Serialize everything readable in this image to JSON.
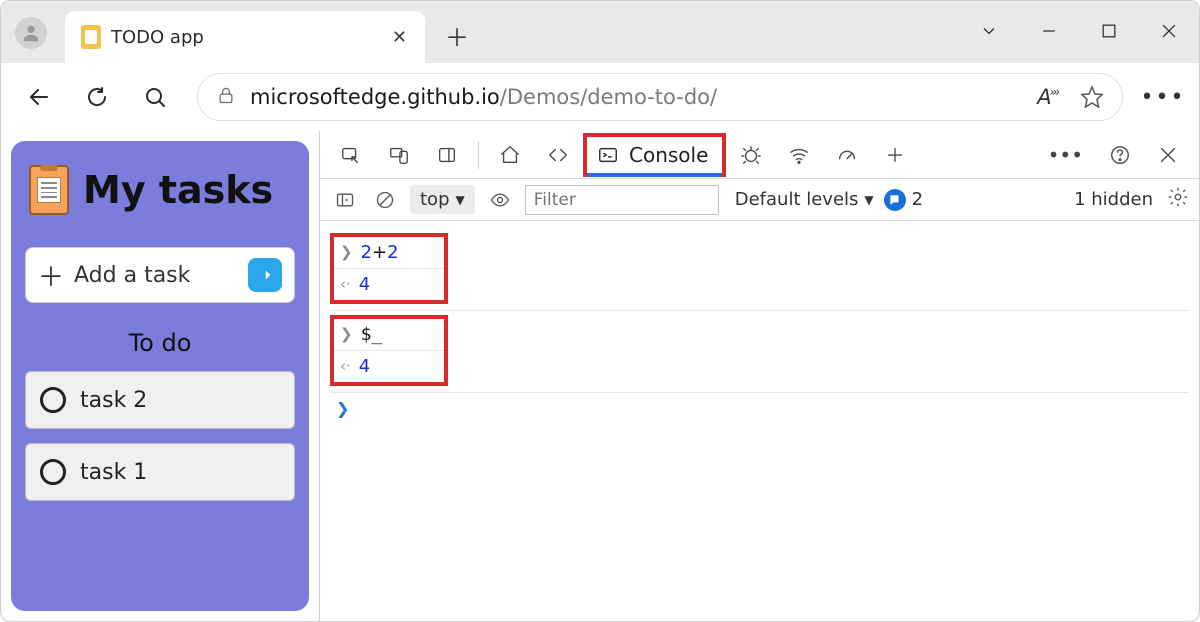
{
  "window": {
    "tab_title": "TODO app"
  },
  "address": {
    "host": "microsoftedge.github.io",
    "path": "/Demos/demo-to-do/",
    "read_aloud_label": "A"
  },
  "app": {
    "title": "My tasks",
    "add_task_placeholder": "Add a task",
    "todo_heading": "To do",
    "tasks": [
      "task 2",
      "task 1"
    ]
  },
  "devtools": {
    "tabs": {
      "console": "Console"
    },
    "toolbar": {
      "context": "top",
      "filter_placeholder": "Filter",
      "levels_label": "Default levels",
      "issue_count": "2",
      "hidden_label": "1 hidden"
    },
    "entries": [
      {
        "input_html": "<span class='num'>2</span><span class='plus-op'>+</span><span class='num'>2</span>",
        "output": "4"
      },
      {
        "input_html": "$_",
        "output": "4"
      }
    ]
  }
}
